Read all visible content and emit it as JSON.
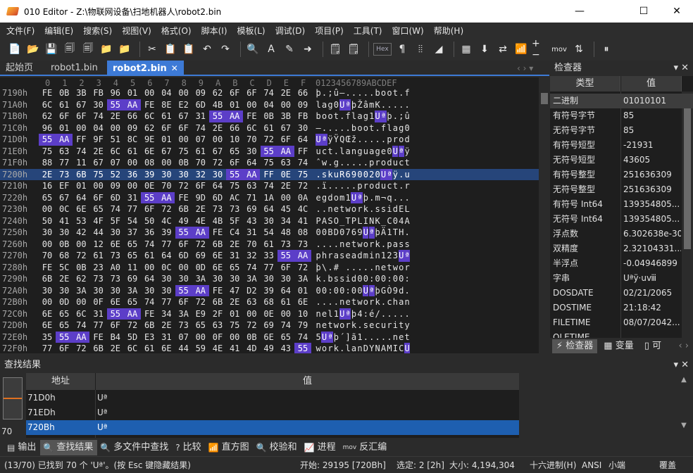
{
  "window": {
    "title": "010 Editor - Z:\\物联网设备\\扫地机器人\\robot2.bin",
    "minimize": "—",
    "maximize": "☐",
    "close": "✕"
  },
  "menu": [
    "文件(F)",
    "编辑(E)",
    "搜索(S)",
    "视图(V)",
    "格式(O)",
    "脚本(I)",
    "模板(L)",
    "调试(D)",
    "项目(P)",
    "工具(T)",
    "窗口(W)",
    "帮助(H)"
  ],
  "toolbar": {
    "icons": [
      "📄",
      "📂",
      "💾",
      "🗐",
      "🗐",
      "📁",
      "📁",
      "✂",
      "📋",
      "📋",
      "↶",
      "↷",
      "🔍",
      "A",
      "✎",
      "➜",
      "🗒",
      "🗒"
    ],
    "hex_label": "Hex",
    "icons2": [
      "¶",
      "⦙⦙",
      "◢",
      "▦",
      "⬇",
      "⇄",
      "📶",
      "+−",
      "mov",
      "⇅",
      "⏸"
    ]
  },
  "tabs": [
    {
      "label": "起始页"
    },
    {
      "label": "robot1.bin"
    },
    {
      "label": "robot2.bin",
      "close": "✕"
    }
  ],
  "tab_nav": "‹ › ▾",
  "hex": {
    "column_header": [
      "0",
      "1",
      "2",
      "3",
      "4",
      "5",
      "6",
      "7",
      "8",
      "9",
      "A",
      "B",
      "C",
      "D",
      "E",
      "F"
    ],
    "ascii_header": "0123456789ABCDEF",
    "rows": [
      {
        "addr": "7190h",
        "bytes": [
          "FE",
          "0B",
          "3B",
          "FB",
          "96",
          "01",
          "00",
          "04",
          "00",
          "09",
          "62",
          "6F",
          "6F",
          "74",
          "2E",
          "66"
        ],
        "hl": [],
        "ascii": "þ.;û–.....boot.f",
        "ahl": []
      },
      {
        "addr": "71A0h",
        "bytes": [
          "6C",
          "61",
          "67",
          "30",
          "55",
          "AA",
          "FE",
          "8E",
          "E2",
          "6D",
          "4B",
          "01",
          "00",
          "04",
          "00",
          "09"
        ],
        "hl": [
          4,
          5
        ],
        "ascii": "lag0UªþŽâmK.....",
        "ahl": [
          4,
          5
        ]
      },
      {
        "addr": "71B0h",
        "bytes": [
          "62",
          "6F",
          "6F",
          "74",
          "2E",
          "66",
          "6C",
          "61",
          "67",
          "31",
          "55",
          "AA",
          "FE",
          "0B",
          "3B",
          "FB"
        ],
        "hl": [
          10,
          11
        ],
        "ascii": "boot.flag1Uªþ.;û",
        "ahl": [
          10,
          11
        ]
      },
      {
        "addr": "71C0h",
        "bytes": [
          "96",
          "01",
          "00",
          "04",
          "00",
          "09",
          "62",
          "6F",
          "6F",
          "74",
          "2E",
          "66",
          "6C",
          "61",
          "67",
          "30"
        ],
        "hl": [],
        "ascii": "–.....boot.flag0",
        "ahl": []
      },
      {
        "addr": "71D0h",
        "bytes": [
          "55",
          "AA",
          "FF",
          "9F",
          "51",
          "8C",
          "9E",
          "01",
          "00",
          "07",
          "00",
          "10",
          "70",
          "72",
          "6F",
          "64"
        ],
        "hl": [
          0,
          1
        ],
        "ascii": "UªÿŸQŒž.....prod",
        "ahl": [
          0,
          1
        ]
      },
      {
        "addr": "71E0h",
        "bytes": [
          "75",
          "63",
          "74",
          "2E",
          "6C",
          "61",
          "6E",
          "67",
          "75",
          "61",
          "67",
          "65",
          "30",
          "55",
          "AA",
          "FF"
        ],
        "hl": [
          13,
          14
        ],
        "ascii": "uct.language0Uªÿ",
        "ahl": [
          13,
          14
        ]
      },
      {
        "addr": "71F0h",
        "bytes": [
          "88",
          "77",
          "11",
          "67",
          "07",
          "00",
          "08",
          "00",
          "0B",
          "70",
          "72",
          "6F",
          "64",
          "75",
          "63",
          "74"
        ],
        "hl": [],
        "ascii": "ˆw.g.....product",
        "ahl": []
      },
      {
        "addr": "7200h",
        "bytes": [
          "2E",
          "73",
          "6B",
          "75",
          "52",
          "36",
          "39",
          "30",
          "30",
          "32",
          "30",
          "55",
          "AA",
          "FF",
          "0E",
          "75"
        ],
        "hl": [
          11,
          12
        ],
        "ascii": ".skuR690020Uªÿ.u",
        "ahl": [
          11,
          12
        ],
        "sel": true
      },
      {
        "addr": "7210h",
        "bytes": [
          "16",
          "EF",
          "01",
          "00",
          "09",
          "00",
          "0E",
          "70",
          "72",
          "6F",
          "64",
          "75",
          "63",
          "74",
          "2E",
          "72"
        ],
        "hl": [],
        "ascii": ".ï.....product.r",
        "ahl": []
      },
      {
        "addr": "7220h",
        "bytes": [
          "65",
          "67",
          "64",
          "6F",
          "6D",
          "31",
          "55",
          "AA",
          "FE",
          "9D",
          "6D",
          "AC",
          "71",
          "1A",
          "00",
          "0A"
        ],
        "hl": [
          6,
          7
        ],
        "ascii": "egdom1Uªþ.m¬q...",
        "ahl": [
          6,
          7
        ]
      },
      {
        "addr": "7230h",
        "bytes": [
          "00",
          "0C",
          "6E",
          "65",
          "74",
          "77",
          "6F",
          "72",
          "6B",
          "2E",
          "73",
          "73",
          "69",
          "64",
          "45",
          "4C"
        ],
        "hl": [],
        "ascii": "..network.ssidEL",
        "ahl": []
      },
      {
        "addr": "7240h",
        "bytes": [
          "50",
          "41",
          "53",
          "4F",
          "5F",
          "54",
          "50",
          "4C",
          "49",
          "4E",
          "4B",
          "5F",
          "43",
          "30",
          "34",
          "41"
        ],
        "hl": [],
        "ascii": "PASO_TPLINK_C04A",
        "ahl": []
      },
      {
        "addr": "7250h",
        "bytes": [
          "30",
          "30",
          "42",
          "44",
          "30",
          "37",
          "36",
          "39",
          "55",
          "AA",
          "FE",
          "C4",
          "31",
          "54",
          "48",
          "08"
        ],
        "hl": [
          8,
          9
        ],
        "ascii": "00BD0769UªþÄ1TH.",
        "ahl": [
          8,
          9
        ]
      },
      {
        "addr": "7260h",
        "bytes": [
          "00",
          "0B",
          "00",
          "12",
          "6E",
          "65",
          "74",
          "77",
          "6F",
          "72",
          "6B",
          "2E",
          "70",
          "61",
          "73",
          "73"
        ],
        "hl": [],
        "ascii": "....network.pass",
        "ahl": []
      },
      {
        "addr": "7270h",
        "bytes": [
          "70",
          "68",
          "72",
          "61",
          "73",
          "65",
          "61",
          "64",
          "6D",
          "69",
          "6E",
          "31",
          "32",
          "33",
          "55",
          "AA"
        ],
        "hl": [
          14,
          15
        ],
        "ascii": "phraseadmin123Uª",
        "ahl": [
          14,
          15
        ]
      },
      {
        "addr": "7280h",
        "bytes": [
          "FE",
          "5C",
          "0B",
          "23",
          "A0",
          "11",
          "00",
          "0C",
          "00",
          "0D",
          "6E",
          "65",
          "74",
          "77",
          "6F",
          "72"
        ],
        "hl": [],
        "ascii": "þ\\.# .....networ",
        "ahl": []
      },
      {
        "addr": "7290h",
        "bytes": [
          "6B",
          "2E",
          "62",
          "73",
          "73",
          "69",
          "64",
          "30",
          "30",
          "3A",
          "30",
          "30",
          "3A",
          "30",
          "30",
          "3A"
        ],
        "hl": [],
        "ascii": "k.bssid00:00:00:",
        "ahl": []
      },
      {
        "addr": "72A0h",
        "bytes": [
          "30",
          "30",
          "3A",
          "30",
          "30",
          "3A",
          "30",
          "30",
          "55",
          "AA",
          "FE",
          "47",
          "D2",
          "39",
          "64",
          "01"
        ],
        "hl": [
          8,
          9
        ],
        "ascii": "00:00:00UªþGÒ9d.",
        "ahl": [
          8,
          9
        ]
      },
      {
        "addr": "72B0h",
        "bytes": [
          "00",
          "0D",
          "00",
          "0F",
          "6E",
          "65",
          "74",
          "77",
          "6F",
          "72",
          "6B",
          "2E",
          "63",
          "68",
          "61",
          "6E"
        ],
        "hl": [],
        "ascii": "....network.chan",
        "ahl": []
      },
      {
        "addr": "72C0h",
        "bytes": [
          "6E",
          "65",
          "6C",
          "31",
          "55",
          "AA",
          "FE",
          "34",
          "3A",
          "E9",
          "2F",
          "01",
          "00",
          "0E",
          "00",
          "10"
        ],
        "hl": [
          4,
          5
        ],
        "ascii": "nel1Uªþ4:é/.....",
        "ahl": [
          4,
          5
        ]
      },
      {
        "addr": "72D0h",
        "bytes": [
          "6E",
          "65",
          "74",
          "77",
          "6F",
          "72",
          "6B",
          "2E",
          "73",
          "65",
          "63",
          "75",
          "72",
          "69",
          "74",
          "79"
        ],
        "hl": [],
        "ascii": "network.security",
        "ahl": []
      },
      {
        "addr": "72E0h",
        "bytes": [
          "35",
          "55",
          "AA",
          "FE",
          "B4",
          "5D",
          "E3",
          "31",
          "07",
          "00",
          "0F",
          "00",
          "0B",
          "6E",
          "65",
          "74"
        ],
        "hl": [
          1,
          2
        ],
        "ascii": "5Uªþ´]ã1.....net",
        "ahl": [
          1,
          2
        ]
      },
      {
        "addr": "72F0h",
        "bytes": [
          "77",
          "6F",
          "72",
          "6B",
          "2E",
          "6C",
          "61",
          "6E",
          "44",
          "59",
          "4E",
          "41",
          "4D",
          "49",
          "43",
          "55"
        ],
        "hl": [
          15
        ],
        "ascii": "work.lanDYNAMICU",
        "ahl": [
          15
        ]
      },
      {
        "addr": "7300h",
        "bytes": [
          "AA",
          "FE",
          "DD",
          "0A",
          "BC",
          "00",
          "01",
          "00",
          "10",
          "00",
          "12",
          "6E",
          "65",
          "74",
          "77",
          "6F"
        ],
        "hl": [
          0
        ],
        "ascii": "ªþÝ.¼......netwo",
        "ahl": [
          0
        ]
      },
      {
        "addr": "7310h",
        "bytes": [
          "72",
          "6B",
          "2E",
          "63",
          "6F",
          "6E",
          "66",
          "69",
          "67",
          "75",
          "72",
          "65",
          "64",
          "31",
          "55",
          "AA"
        ],
        "hl": [
          14,
          15
        ],
        "ascii": "rk.configured1Uª",
        "ahl": [
          14,
          15
        ]
      }
    ]
  },
  "inspector": {
    "title": "检查器",
    "head_ctrls": "▾ ✕",
    "col_type": "类型",
    "col_value": "值",
    "rows": [
      {
        "k": "二进制",
        "v": "01010101"
      },
      {
        "k": "有符号字节",
        "v": "85"
      },
      {
        "k": "无符号字节",
        "v": "85"
      },
      {
        "k": "有符号短型",
        "v": "-21931"
      },
      {
        "k": "无符号短型",
        "v": "43605"
      },
      {
        "k": "有符号整型",
        "v": "251636309"
      },
      {
        "k": "无符号整型",
        "v": "251636309"
      },
      {
        "k": "有符号 Int64",
        "v": "139354805..."
      },
      {
        "k": "无符号 Int64",
        "v": "139354805..."
      },
      {
        "k": "浮点数",
        "v": "6.302638e-30"
      },
      {
        "k": "双精度",
        "v": "2.32104331..."
      },
      {
        "k": "半浮点",
        "v": "-0.04946899"
      },
      {
        "k": "字串",
        "v": "Uªÿ·uⅷ"
      },
      {
        "k": "DOSDATE",
        "v": "02/21/2065"
      },
      {
        "k": "DOSTIME",
        "v": "21:18:42"
      },
      {
        "k": "FILETIME",
        "v": "08/07/2042..."
      },
      {
        "k": "OLETIME",
        "v": ""
      }
    ],
    "tabs": [
      {
        "icon": "⚡",
        "label": "检查器"
      },
      {
        "icon": "▦",
        "label": "变量"
      },
      {
        "icon": "▯",
        "label": "可"
      }
    ],
    "tab_nav": "‹ ›"
  },
  "results": {
    "title": "查找结果",
    "head_ctrls": "▾ ✕",
    "count": "70",
    "col_addr": "地址",
    "col_value": "值",
    "rows": [
      {
        "addr": "71D0h",
        "value": "Uª"
      },
      {
        "addr": "71EDh",
        "value": "Uª"
      },
      {
        "addr": "720Bh",
        "value": "Uª",
        "sel": true
      }
    ],
    "scroll_up": "▲",
    "scroll_down": "▼"
  },
  "bottom_tabs": [
    {
      "icon": "▤",
      "label": "输出"
    },
    {
      "icon": "🔍",
      "label": "查找结果",
      "active": true
    },
    {
      "icon": "🔍",
      "label": "多文件中查找"
    },
    {
      "icon": "?",
      "label": "比较"
    },
    {
      "icon": "📶",
      "label": "直方图"
    },
    {
      "icon": "🔍",
      "label": "校验和"
    },
    {
      "icon": "📈",
      "label": "进程"
    },
    {
      "icon": "mov",
      "label": "反汇编"
    }
  ],
  "status": {
    "message": "(13/70) 已找到 70 个 'Uª'。(按 Esc 键隐藏结果)",
    "start": "开始: 29195 [720Bh]",
    "selected": "选定: 2 [2h]",
    "size": "大小: 4,194,304",
    "mode": "十六进制(H)",
    "encoding": "ANSI",
    "endian": "小端",
    "overwrite": "覆盖"
  }
}
